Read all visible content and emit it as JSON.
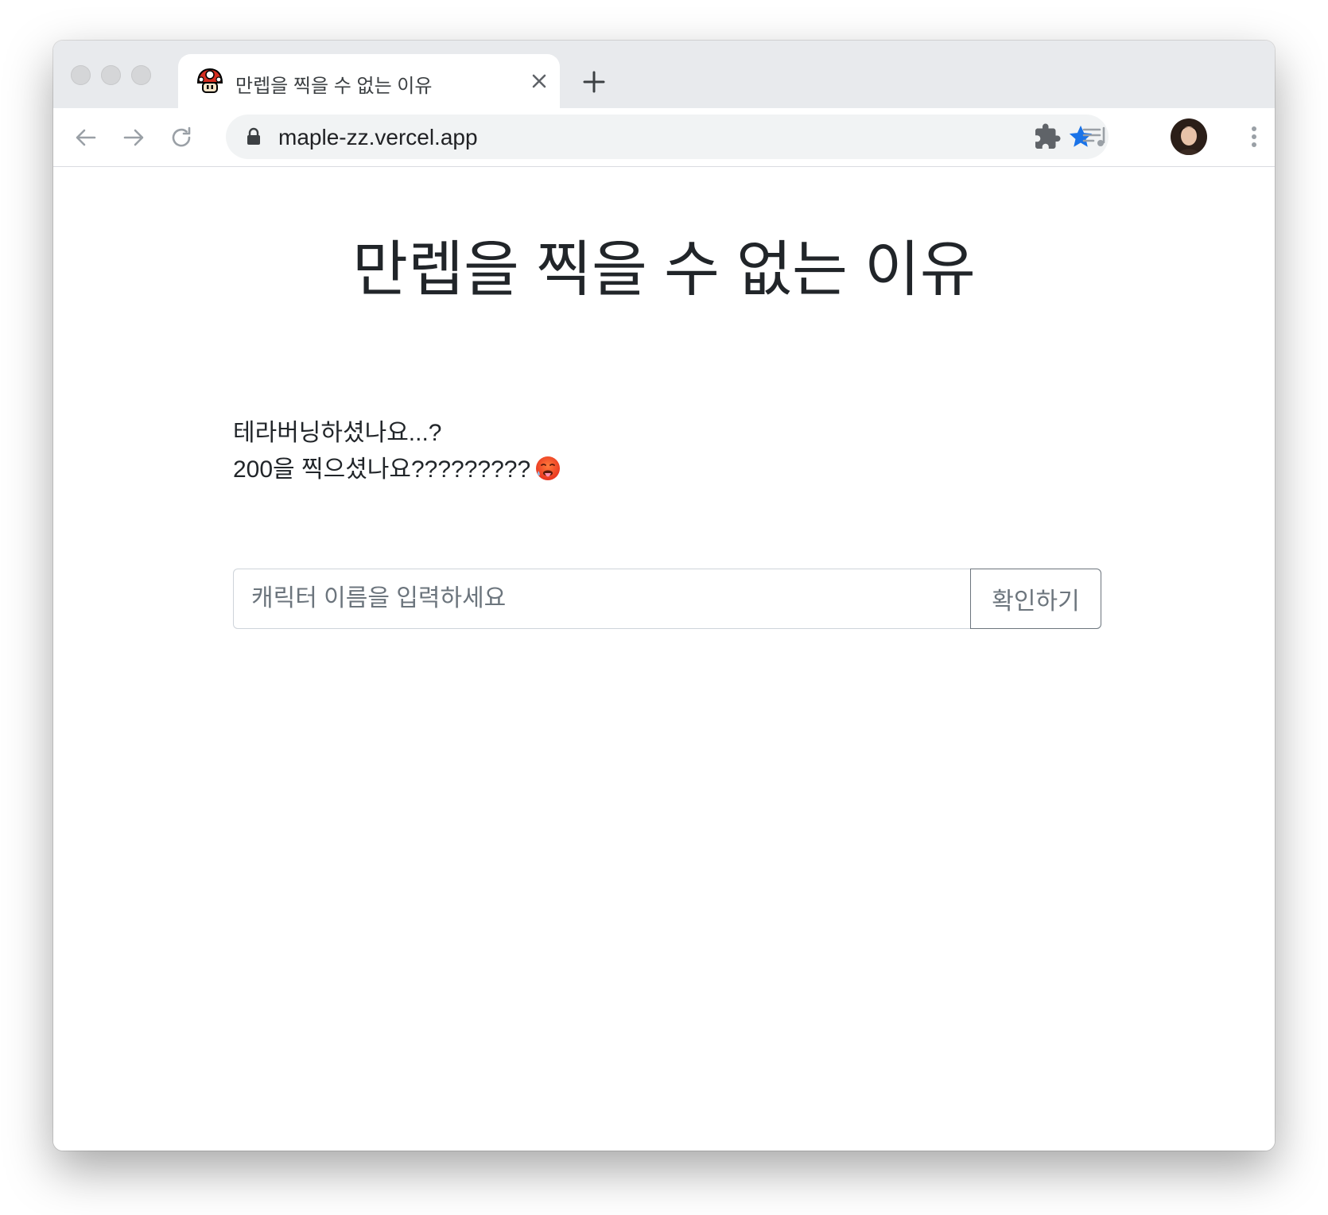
{
  "browser": {
    "tab": {
      "title": "만렙을 찍을 수 없는 이유",
      "favicon": "mushroom-icon"
    },
    "omnibox": {
      "url": "maple-zz.vercel.app"
    },
    "colors": {
      "star": "#1a73e8",
      "tabstrip": "#e8eaed",
      "omnibox": "#f1f3f4"
    }
  },
  "page": {
    "title": "만렙을 찍을 수 없는 이유",
    "lines": [
      "테라버닝하셨나요...?",
      "200을 찍으셨나요?????????"
    ],
    "emoji": "hot-face-emoji",
    "search": {
      "placeholder": "캐릭터 이름을 입력하세요",
      "value": ""
    },
    "confirm_label": "확인하기"
  }
}
